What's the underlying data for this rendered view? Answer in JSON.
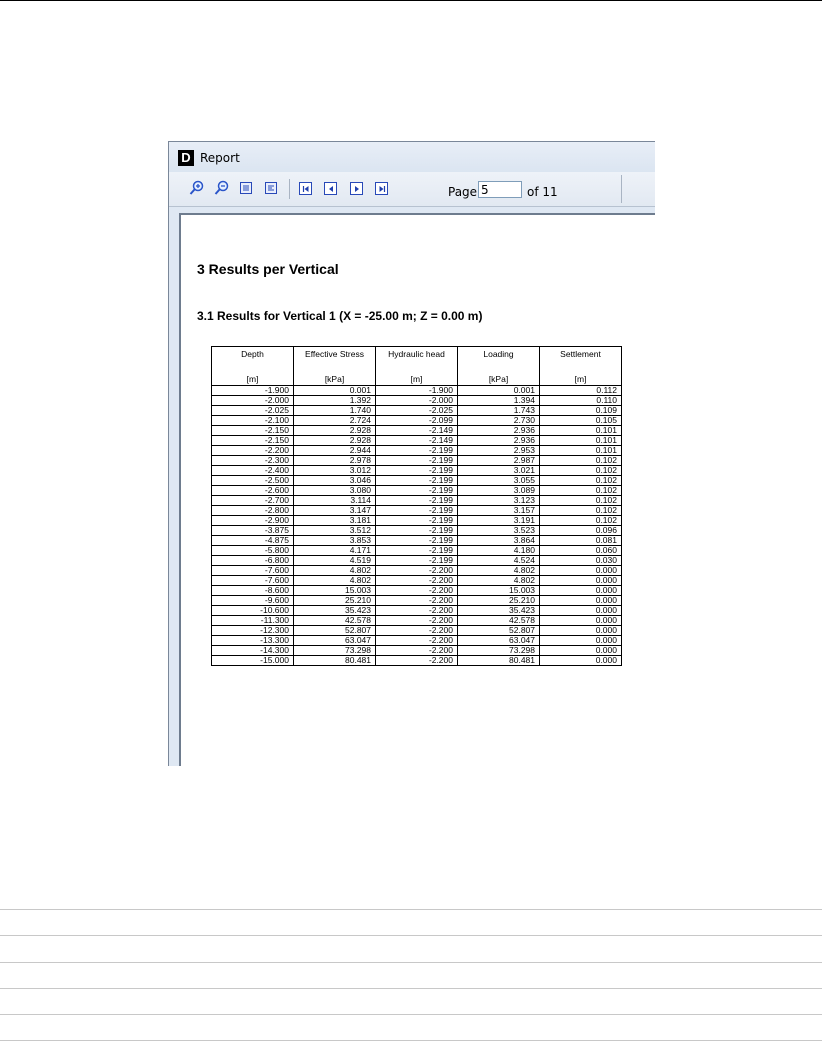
{
  "window": {
    "title": "Report",
    "app_icon": "D"
  },
  "toolbar": {
    "icons": [
      "zoom-in-icon",
      "zoom-out-icon",
      "fit-page-icon",
      "fit-width-icon",
      "first-page-icon",
      "previous-page-icon",
      "next-page-icon",
      "last-page-icon"
    ],
    "page_label": "Page",
    "page_value": "5",
    "page_total": "of 11"
  },
  "report": {
    "heading": "3 Results per Vertical",
    "subheading": "3.1 Results for Vertical 1 (X = -25.00 m;  Z = 0.00 m)",
    "columns": [
      {
        "name": "Depth",
        "unit": "[m]"
      },
      {
        "name": "Effective Stress",
        "unit": "[kPa]"
      },
      {
        "name": "Hydraulic head",
        "unit": "[m]"
      },
      {
        "name": "Loading",
        "unit": "[kPa]"
      },
      {
        "name": "Settlement",
        "unit": "[m]"
      }
    ],
    "rows": [
      [
        "-1.900",
        "0.001",
        "-1.900",
        "0.001",
        "0.112"
      ],
      [
        "-2.000",
        "1.392",
        "-2.000",
        "1.394",
        "0.110"
      ],
      [
        "-2.025",
        "1.740",
        "-2.025",
        "1.743",
        "0.109"
      ],
      [
        "-2.100",
        "2.724",
        "-2.099",
        "2.730",
        "0.105"
      ],
      [
        "-2.150",
        "2.928",
        "-2.149",
        "2.936",
        "0.101"
      ],
      [
        "-2.150",
        "2.928",
        "-2.149",
        "2.936",
        "0.101"
      ],
      [
        "-2.200",
        "2.944",
        "-2.199",
        "2.953",
        "0.101"
      ],
      [
        "-2.300",
        "2.978",
        "-2.199",
        "2.987",
        "0.102"
      ],
      [
        "-2.400",
        "3.012",
        "-2.199",
        "3.021",
        "0.102"
      ],
      [
        "-2.500",
        "3.046",
        "-2.199",
        "3.055",
        "0.102"
      ],
      [
        "-2.600",
        "3.080",
        "-2.199",
        "3.089",
        "0.102"
      ],
      [
        "-2.700",
        "3.114",
        "-2.199",
        "3.123",
        "0.102"
      ],
      [
        "-2.800",
        "3.147",
        "-2.199",
        "3.157",
        "0.102"
      ],
      [
        "-2.900",
        "3.181",
        "-2.199",
        "3.191",
        "0.102"
      ],
      [
        "-3.875",
        "3.512",
        "-2.199",
        "3.523",
        "0.096"
      ],
      [
        "-4.875",
        "3.853",
        "-2.199",
        "3.864",
        "0.081"
      ],
      [
        "-5.800",
        "4.171",
        "-2.199",
        "4.180",
        "0.060"
      ],
      [
        "-6.800",
        "4.519",
        "-2.199",
        "4.524",
        "0.030"
      ],
      [
        "-7.600",
        "4.802",
        "-2.200",
        "4.802",
        "0.000"
      ],
      [
        "-7.600",
        "4.802",
        "-2.200",
        "4.802",
        "0.000"
      ],
      [
        "-8.600",
        "15.003",
        "-2.200",
        "15.003",
        "0.000"
      ],
      [
        "-9.600",
        "25.210",
        "-2.200",
        "25.210",
        "0.000"
      ],
      [
        "-10.600",
        "35.423",
        "-2.200",
        "35.423",
        "0.000"
      ],
      [
        "-11.300",
        "42.578",
        "-2.200",
        "42.578",
        "0.000"
      ],
      [
        "-12.300",
        "52.807",
        "-2.200",
        "52.807",
        "0.000"
      ],
      [
        "-13.300",
        "63.047",
        "-2.200",
        "63.047",
        "0.000"
      ],
      [
        "-14.300",
        "73.298",
        "-2.200",
        "73.298",
        "0.000"
      ],
      [
        "-15.000",
        "80.481",
        "-2.200",
        "80.481",
        "0.000"
      ]
    ]
  }
}
